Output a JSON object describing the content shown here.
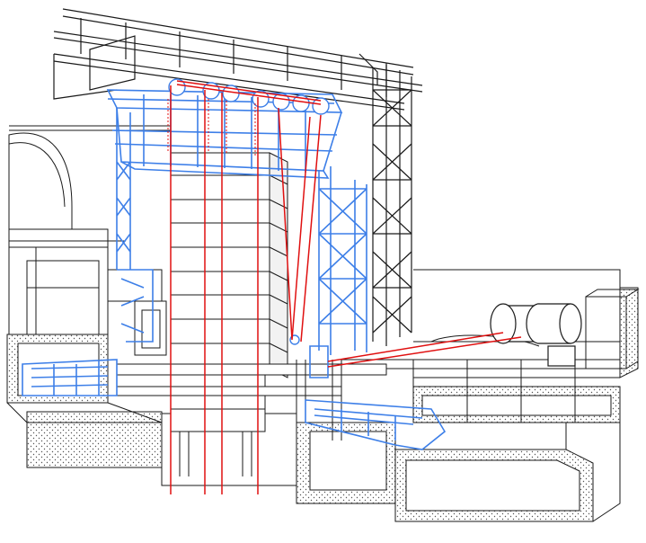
{
  "colors": {
    "structure": "#1a1a1a",
    "machinery": "#3d7fe8",
    "cables": "#e01010",
    "concrete_fill": "#ffffff",
    "hatch": "#555555",
    "background": "#ffffff"
  },
  "components": [
    {
      "id": "overhead-crane-girders",
      "icon": "steel-truss"
    },
    {
      "id": "hoist-frame",
      "icon": "blue-frame"
    },
    {
      "id": "sheave-pulleys",
      "icon": "pulley"
    },
    {
      "id": "hoist-cables",
      "icon": "red-line"
    },
    {
      "id": "gate-leaf",
      "icon": "panel-stack"
    },
    {
      "id": "guide-tower",
      "icon": "lattice-tower"
    },
    {
      "id": "winch-drums",
      "icon": "drum"
    },
    {
      "id": "concrete-foundation",
      "icon": "hatched-block"
    }
  ]
}
